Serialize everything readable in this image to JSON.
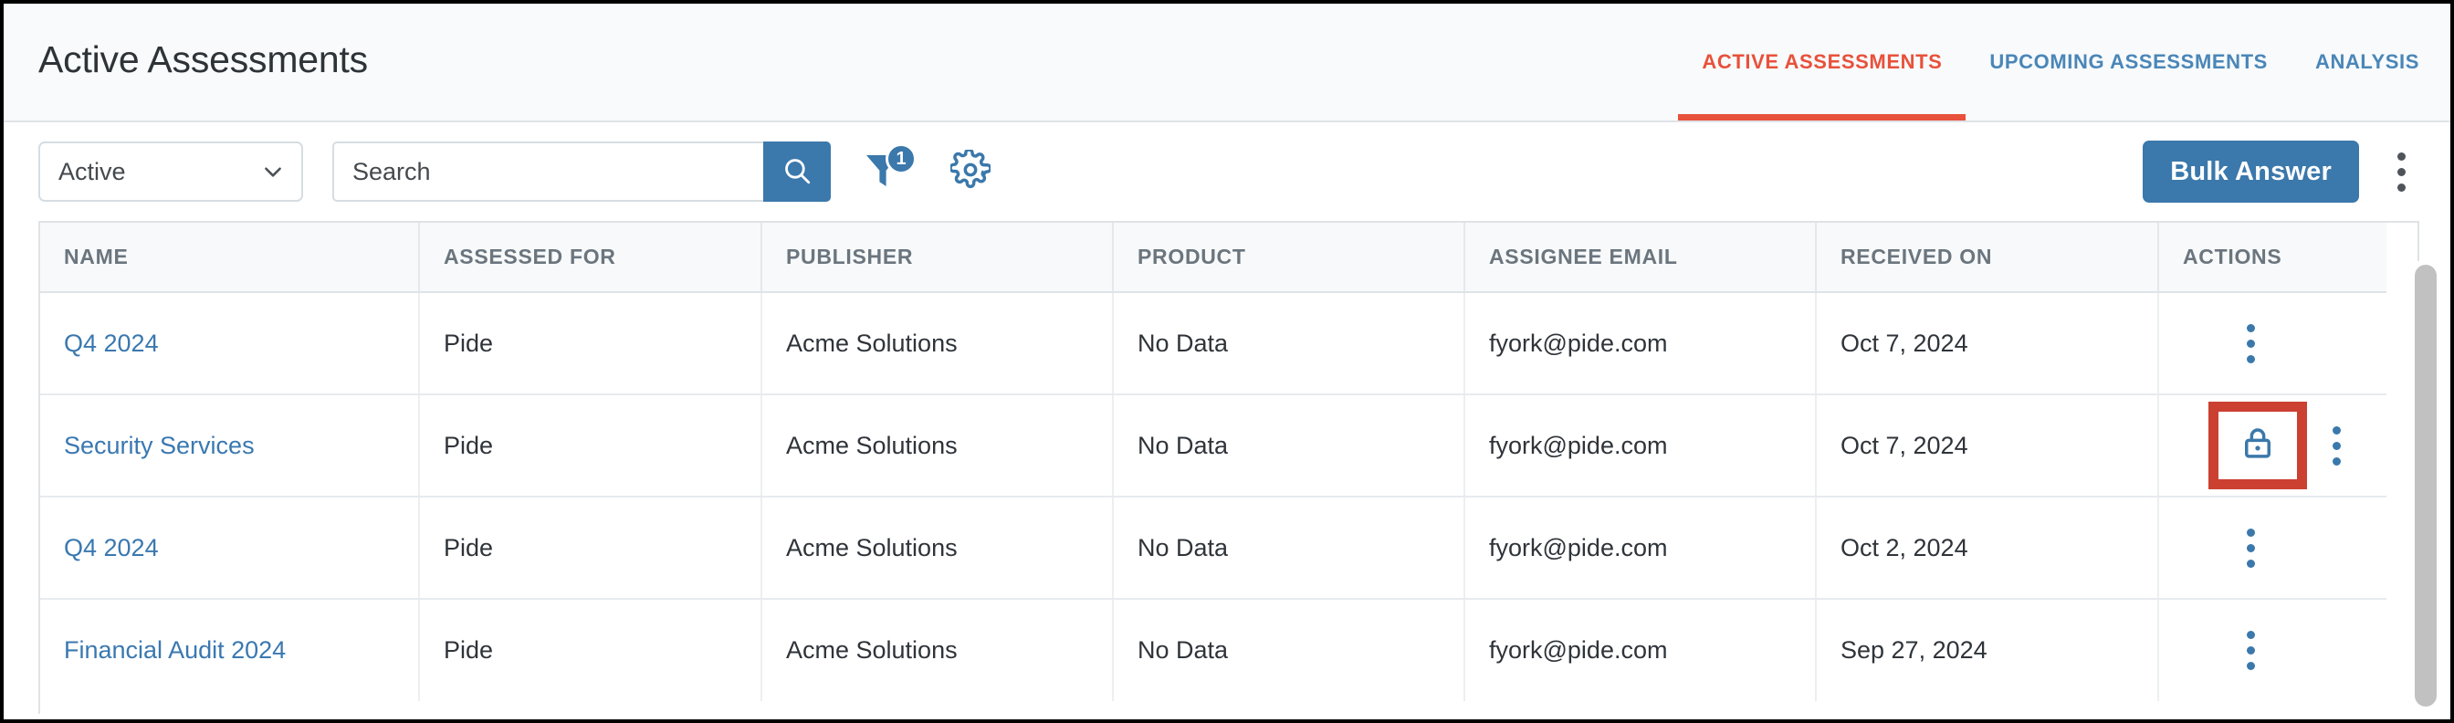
{
  "header": {
    "title": "Active Assessments",
    "tabs": [
      {
        "label": "ACTIVE ASSESSMENTS",
        "active": true
      },
      {
        "label": "UPCOMING ASSESSMENTS",
        "active": false
      },
      {
        "label": "ANALYSIS",
        "active": false
      }
    ]
  },
  "toolbar": {
    "status_filter": {
      "value": "Active",
      "icon": "chevron-down-icon"
    },
    "search": {
      "value": "",
      "placeholder": "Search",
      "button_icon": "search-icon"
    },
    "filter_icon": {
      "name": "filter-icon",
      "badge": "1"
    },
    "settings_icon": {
      "name": "gear-icon"
    },
    "bulk_answer_label": "Bulk Answer",
    "overflow_icon": "kebab-menu-icon"
  },
  "table": {
    "columns": [
      "NAME",
      "ASSESSED FOR",
      "PUBLISHER",
      "PRODUCT",
      "ASSIGNEE EMAIL",
      "RECEIVED ON",
      "ACTIONS"
    ],
    "rows": [
      {
        "name": "Q4 2024",
        "assessed_for": "Pide",
        "publisher": "Acme Solutions",
        "product": "No Data",
        "assignee_email": "fyork@pide.com",
        "received_on": "Oct 7, 2024",
        "locked": false
      },
      {
        "name": "Security Services",
        "assessed_for": "Pide",
        "publisher": "Acme Solutions",
        "product": "No Data",
        "assignee_email": "fyork@pide.com",
        "received_on": "Oct 7, 2024",
        "locked": true
      },
      {
        "name": "Q4 2024",
        "assessed_for": "Pide",
        "publisher": "Acme Solutions",
        "product": "No Data",
        "assignee_email": "fyork@pide.com",
        "received_on": "Oct 2, 2024",
        "locked": false
      },
      {
        "name": "Financial Audit 2024",
        "assessed_for": "Pide",
        "publisher": "Acme Solutions",
        "product": "No Data",
        "assignee_email": "fyork@pide.com",
        "received_on": "Sep 27, 2024",
        "locked": false
      }
    ]
  },
  "colors": {
    "accent_blue": "#3b78ab",
    "link_blue": "#3a78b0",
    "active_tab_orange": "#e8513b",
    "highlight_red": "#cc4032",
    "header_bg": "#f8fafb"
  }
}
